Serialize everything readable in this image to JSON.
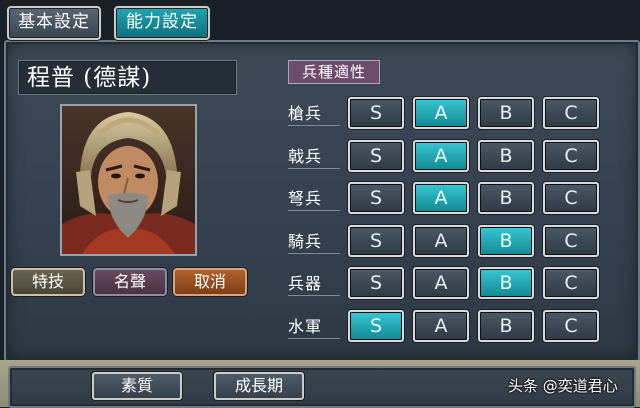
{
  "tabs": {
    "basic_label": "基本設定",
    "ability_label": "能力設定"
  },
  "officer": {
    "name": "程普 (德謀)"
  },
  "actions": {
    "skill_label": "特技",
    "fame_label": "名聲",
    "cancel_label": "取消"
  },
  "aptitude": {
    "title": "兵種適性",
    "grade_labels": [
      "S",
      "A",
      "B",
      "C"
    ],
    "rows": [
      {
        "name": "槍兵",
        "selected": "A"
      },
      {
        "name": "戟兵",
        "selected": "A"
      },
      {
        "name": "弩兵",
        "selected": "A"
      },
      {
        "name": "騎兵",
        "selected": "B"
      },
      {
        "name": "兵器",
        "selected": "B"
      },
      {
        "name": "水軍",
        "selected": "S"
      }
    ]
  },
  "bottom": {
    "quality_label": "素質",
    "growth_label": "成長期"
  },
  "watermark": "头条 @奕道君心",
  "colors": {
    "selected_grade": "#1fa6b3",
    "unselected_grade": "#3f4c58",
    "panel_bg": "#354150"
  }
}
